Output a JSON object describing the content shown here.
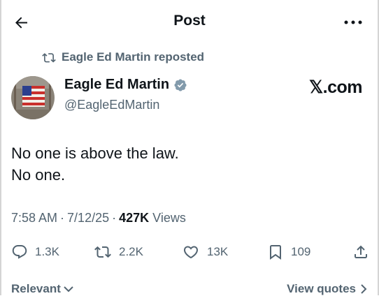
{
  "header": {
    "title": "Post"
  },
  "repost": {
    "text": "Eagle Ed Martin reposted"
  },
  "author": {
    "name": "Eagle Ed Martin",
    "handle": "@EagleEdMartin",
    "verified": true,
    "verified_color": "#829aab"
  },
  "source": {
    "logo_text": "𝕏.com"
  },
  "tweet": {
    "text": "No one is above the law.\nNo one."
  },
  "meta": {
    "time": "7:58 AM",
    "separator": "·",
    "date": "7/12/25",
    "views_count": "427K",
    "views_label": "Views"
  },
  "actions": {
    "replies": "1.3K",
    "reposts": "2.2K",
    "likes": "13K",
    "bookmarks": "109",
    "icons": [
      "reply-icon",
      "repost-icon",
      "like-icon",
      "bookmark-icon",
      "share-icon"
    ]
  },
  "footer": {
    "sort_label": "Relevant",
    "view_quotes": "View quotes"
  },
  "colors": {
    "text": "#0f1419",
    "secondary": "#536471"
  }
}
